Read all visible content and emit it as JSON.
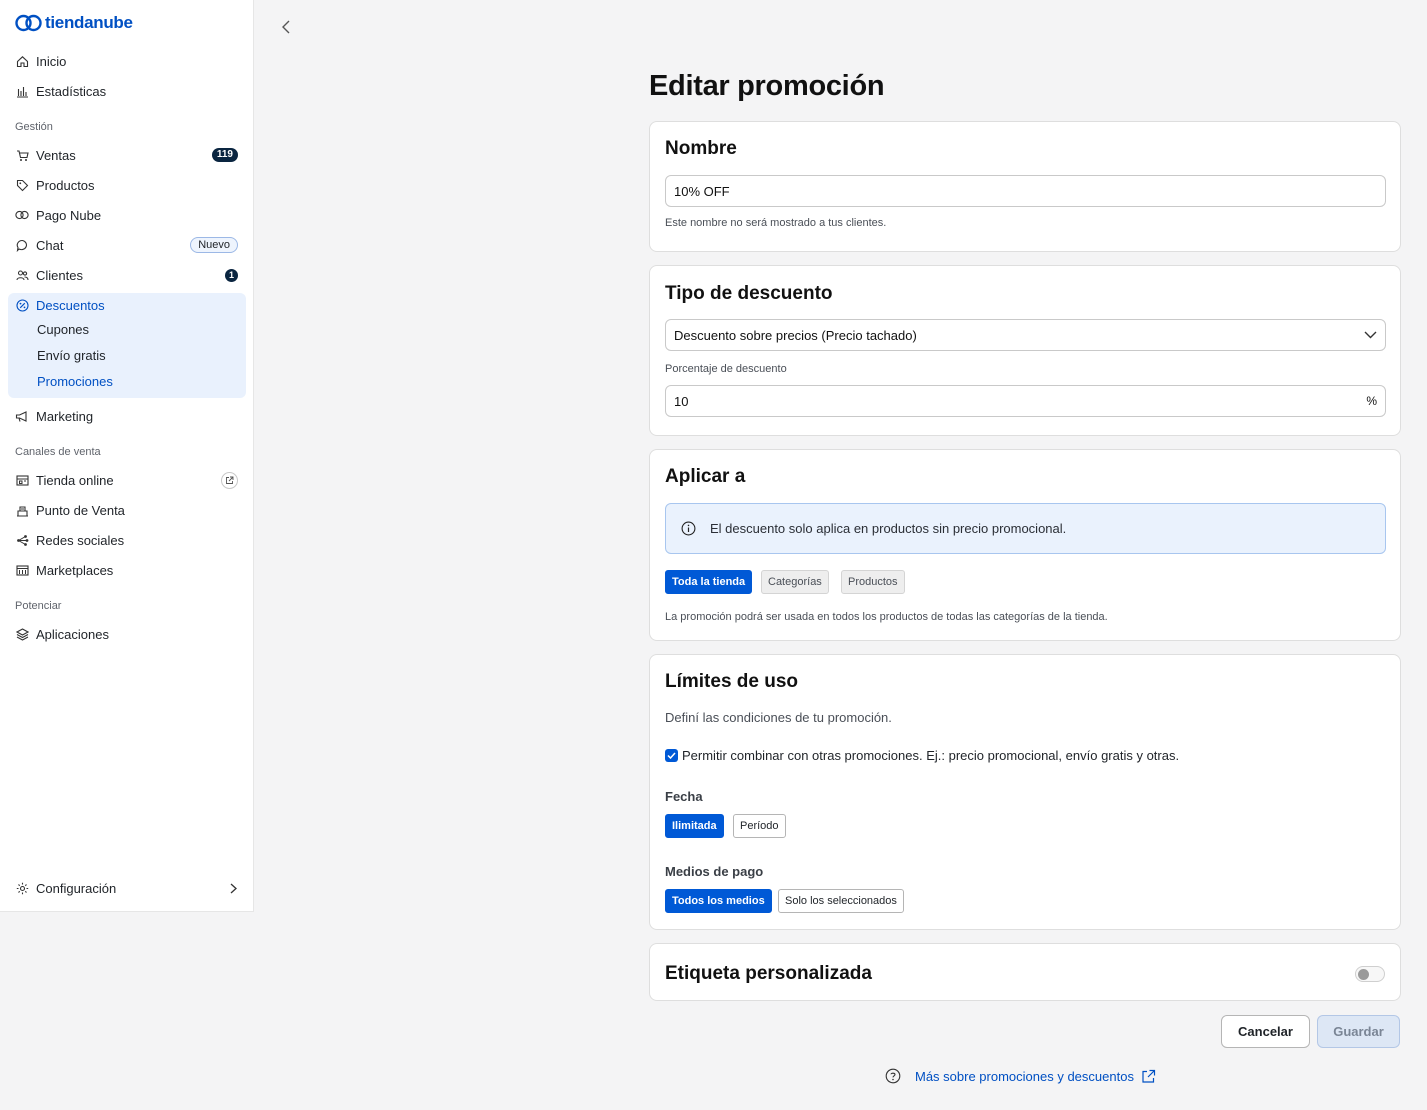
{
  "brand": {
    "name": "tiendanube",
    "accent": "#0050c3",
    "primary": "#0059d6"
  },
  "sidebar": {
    "top_items": [
      {
        "label": "Inicio",
        "icon": "home-icon"
      },
      {
        "label": "Estadísticas",
        "icon": "bar-chart-icon"
      }
    ],
    "sections": {
      "gestion": "Gestión",
      "canales": "Canales de venta",
      "potenciar": "Potenciar"
    },
    "gestion_items": [
      {
        "label": "Ventas",
        "icon": "cart-icon",
        "badge": "119"
      },
      {
        "label": "Productos",
        "icon": "tag-icon"
      },
      {
        "label": "Pago Nube",
        "icon": "pago-nube-icon"
      },
      {
        "label": "Chat",
        "icon": "chat-icon",
        "badge": "Nuevo"
      },
      {
        "label": "Clientes",
        "icon": "users-icon",
        "badge": "1"
      },
      {
        "label": "Descuentos",
        "icon": "discount-icon"
      },
      {
        "label": "Marketing",
        "icon": "megaphone-icon"
      }
    ],
    "descuentos_sub": [
      "Cupones",
      "Envío gratis",
      "Promociones"
    ],
    "canales_items": [
      {
        "label": "Tienda online",
        "icon": "store-icon"
      },
      {
        "label": "Punto de Venta",
        "icon": "pos-icon"
      },
      {
        "label": "Redes sociales",
        "icon": "share-icon"
      },
      {
        "label": "Marketplaces",
        "icon": "marketplace-icon"
      }
    ],
    "potenciar_items": [
      {
        "label": "Aplicaciones",
        "icon": "apps-icon"
      }
    ],
    "settings": {
      "label": "Configuración",
      "icon": "gear-icon"
    }
  },
  "page": {
    "title": "Editar promoción",
    "nombre": {
      "title": "Nombre",
      "value": "10% OFF",
      "helper": "Este nombre no será mostrado a tus clientes."
    },
    "tipo": {
      "title": "Tipo de descuento",
      "select_value": "Descuento sobre precios (Precio tachado)",
      "percent_label": "Porcentaje de descuento",
      "percent_value": "10",
      "percent_suffix": "%"
    },
    "aplicar": {
      "title": "Aplicar a",
      "info": "El descuento solo aplica en productos sin precio promocional.",
      "options": [
        "Toda la tienda",
        "Categorías",
        "Productos"
      ],
      "helper": "La promoción podrá ser usada en todos los productos de todas las categorías de la tienda."
    },
    "limites": {
      "title": "Límites de uso",
      "subtitle": "Definí las condiciones de tu promoción.",
      "combine_label": "Permitir combinar con otras promociones. Ej.: precio promocional, envío gratis y otras.",
      "combine_checked": true,
      "fecha_label": "Fecha",
      "fecha_options": [
        "Ilimitada",
        "Período"
      ],
      "medios_label": "Medios de pago",
      "medios_options": [
        "Todos los medios",
        "Solo los seleccionados"
      ]
    },
    "etiqueta": {
      "title": "Etiqueta personalizada",
      "enabled": false
    },
    "actions": {
      "cancel": "Cancelar",
      "save": "Guardar"
    },
    "help_link": "Más sobre promociones y descuentos"
  }
}
